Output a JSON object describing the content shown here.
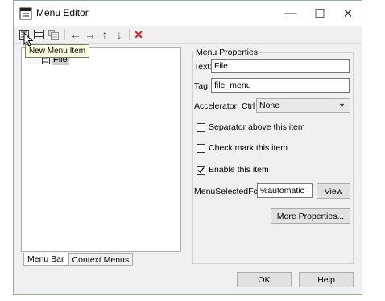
{
  "window": {
    "title": "Menu Editor",
    "controls": {
      "minimize": "—",
      "maximize": "☐",
      "close": "✕"
    }
  },
  "toolbar": {
    "buttons": [
      {
        "name": "new-menu-icon",
        "glyph": ""
      },
      {
        "name": "new-menu-item-icon",
        "glyph": ""
      },
      {
        "name": "new-context-menu-icon",
        "glyph": ""
      },
      {
        "name": "move-left-icon",
        "glyph": "←"
      },
      {
        "name": "move-right-icon",
        "glyph": "→"
      },
      {
        "name": "move-up-icon",
        "glyph": "↑"
      },
      {
        "name": "move-down-icon",
        "glyph": "↓"
      },
      {
        "name": "delete-icon",
        "glyph": "✕"
      }
    ],
    "tooltip": "New Menu Item"
  },
  "tree": {
    "items": [
      {
        "label": "File"
      }
    ]
  },
  "tabs": {
    "menu_bar": "Menu Bar",
    "context_menus": "Context Menus"
  },
  "properties": {
    "legend": "Menu Properties",
    "text_label": "Text:",
    "text_value": "File",
    "tag_label": "Tag:",
    "tag_value": "file_menu",
    "accelerator_label": "Accelerator: Ctrl +",
    "accelerator_value": "None",
    "separator_label": "Separator above this item",
    "separator_checked": false,
    "checkmark_label": "Check mark this item",
    "checkmark_checked": false,
    "enable_label": "Enable this item",
    "enable_checked": true,
    "fcn_label": "MenuSelectedFcn:",
    "fcn_value": "%automatic",
    "view_label": "View",
    "more_label": "More Properties..."
  },
  "footer": {
    "ok_label": "OK",
    "help_label": "Help"
  },
  "colors": {
    "delete": "#e81123",
    "window_bg": "#f0f0f0",
    "border": "#9aa6b8"
  }
}
